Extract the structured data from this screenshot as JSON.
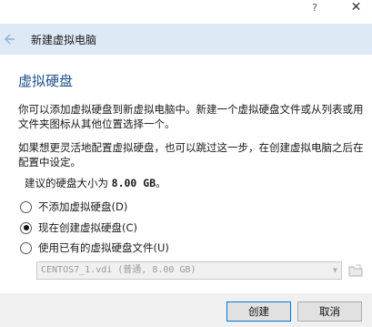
{
  "titlebar": {
    "help_label": "?",
    "close_label": "✕"
  },
  "header": {
    "back_icon": "arrow-left-icon",
    "title": "新建虚拟电脑"
  },
  "page": {
    "title": "虚拟硬盘",
    "paragraph1": "你可以添加虚拟硬盘到新虚拟电脑中。新建一个虚拟硬盘文件或从列表或用文件夹图标从其他位置选择一个。",
    "paragraph2": "如果想更灵活地配置虚拟硬盘，也可以跳过这一步，在创建虚拟电脑之后在配置中设定。",
    "suggest_prefix": "建议的硬盘大小为 ",
    "suggest_size": "8.00 GB",
    "suggest_suffix": "。"
  },
  "options": [
    {
      "label": "不添加虚拟硬盘(D)",
      "checked": false
    },
    {
      "label": "现在创建虚拟硬盘(C)",
      "checked": true
    },
    {
      "label": "使用已有的虚拟硬盘文件(U)",
      "checked": false
    }
  ],
  "file_select": {
    "value": "CENTOS7_1.vdi (普通, 8.00 GB)",
    "disabled": true
  },
  "buttons": {
    "create": "创建",
    "cancel": "取消"
  }
}
